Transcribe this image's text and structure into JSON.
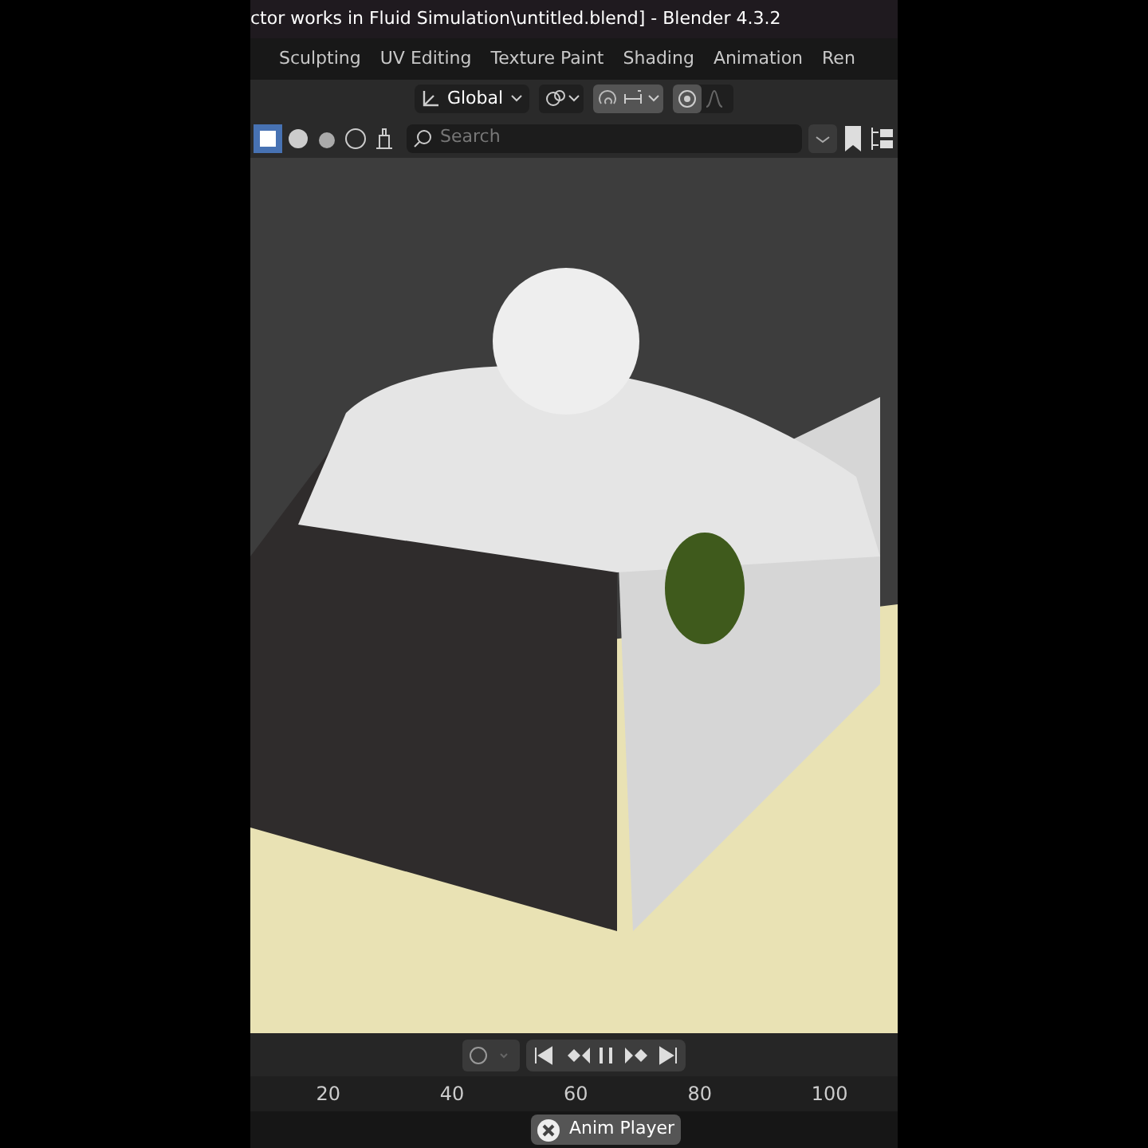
{
  "window": {
    "title": "ctor works in Fluid Simulation\\untitled.blend] - Blender 4.3.2"
  },
  "workspace_tabs": [
    {
      "label": "Sculpting",
      "selected": false
    },
    {
      "label": "UV Editing",
      "selected": false
    },
    {
      "label": "Texture Paint",
      "selected": false
    },
    {
      "label": "Shading",
      "selected": false
    },
    {
      "label": "Animation",
      "selected": false
    },
    {
      "label": "Ren",
      "selected": false
    }
  ],
  "header": {
    "transform_orientation": "Global",
    "snap": true,
    "proportional_editing": true
  },
  "viewport_header": {
    "search": {
      "placeholder": "Search"
    }
  },
  "playback": {
    "playing": true
  },
  "timeline": {
    "ticks": [
      "20",
      "40",
      "60",
      "80",
      "100"
    ]
  },
  "status_bar": {
    "anim_player": "Anim Player"
  }
}
